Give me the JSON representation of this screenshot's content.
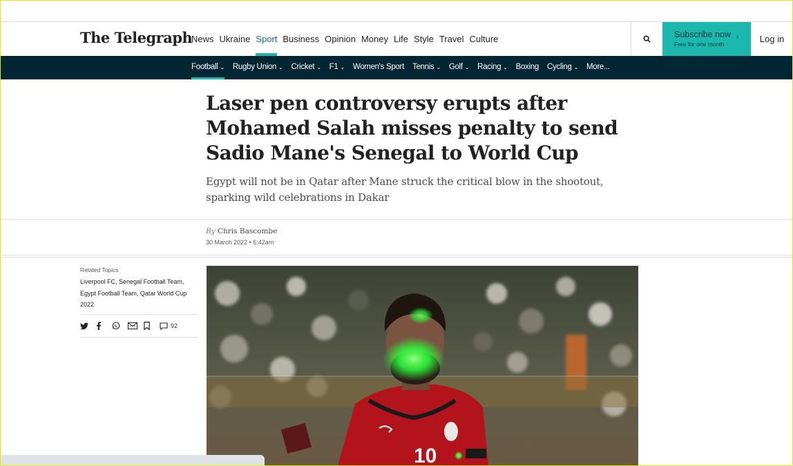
{
  "masthead": {
    "logo": "The Telegraph",
    "nav": [
      "News",
      "Ukraine",
      "Sport",
      "Business",
      "Opinion",
      "Money",
      "Life",
      "Style",
      "Travel",
      "Culture"
    ],
    "active_nav": "Sport",
    "search_icon": "search-icon",
    "subscribe_label": "Subscribe now",
    "subscribe_sub": "Free for one month",
    "login_label": "Log in"
  },
  "sport_nav": {
    "items": [
      {
        "label": "Football",
        "caret": true
      },
      {
        "label": "Rugby Union",
        "caret": true
      },
      {
        "label": "Cricket",
        "caret": true
      },
      {
        "label": "F1",
        "caret": true
      },
      {
        "label": "Women's Sport",
        "caret": false
      },
      {
        "label": "Tennis",
        "caret": true
      },
      {
        "label": "Golf",
        "caret": true
      },
      {
        "label": "Racing",
        "caret": true
      },
      {
        "label": "Boxing",
        "caret": false
      },
      {
        "label": "Cycling",
        "caret": true
      },
      {
        "label": "More...",
        "caret": false
      }
    ],
    "active": "Football"
  },
  "article": {
    "headline": "Laser pen controversy erupts after Mohamed Salah misses penalty to send Sadio Mane's Senegal to World Cup",
    "standfirst": "Egypt will not be in Qatar after Mane struck the critical blow in the shootout, sparking wild celebrations in Dakar",
    "byline_prefix": "By",
    "author": "Chris Bascombe",
    "date": "30 March 2022 • 6:42am"
  },
  "sidebar": {
    "related_label": "Related Topics",
    "topics": [
      "Liverpool FC",
      "Senegal Football Team",
      "Egypt Football Team",
      "Qatar World Cup 2022"
    ],
    "share_icons": [
      "twitter-icon",
      "facebook-icon",
      "whatsapp-icon",
      "email-icon",
      "bookmark-icon",
      "comment-icon"
    ],
    "comment_count": "92"
  },
  "hero_image": {
    "jersey_number": "10"
  },
  "colors": {
    "accent": "#1cb8ad",
    "sport_nav_bg": "#032634",
    "active_nav_text": "#0e6b7a",
    "laser_green": "#2bff3a",
    "jersey_red": "#b3141c"
  }
}
